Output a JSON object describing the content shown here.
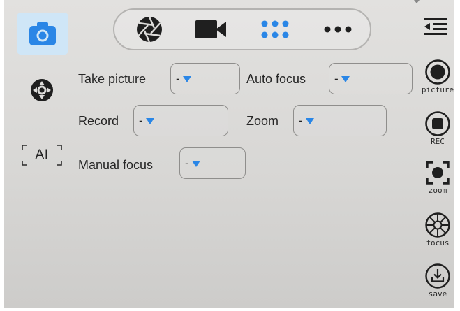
{
  "colors": {
    "accent": "#2a86e6",
    "icon": "#1f1f1f",
    "mode_tile_bg": "#cfe6f7"
  },
  "left_rail": {
    "camera_icon": "camera-icon",
    "settings_icon": "settings-wheel-icon",
    "ai_label": "AI"
  },
  "mode_bar": {
    "items": [
      {
        "icon": "aperture-icon"
      },
      {
        "icon": "video-camera-icon"
      },
      {
        "icon": "grid-dots-icon"
      },
      {
        "icon": "more-horizontal-icon"
      }
    ]
  },
  "form": {
    "take_picture": {
      "label": "Take picture",
      "value": "-"
    },
    "auto_focus": {
      "label": "Auto focus",
      "value": "-"
    },
    "record": {
      "label": "Record",
      "value": "-"
    },
    "zoom": {
      "label": "Zoom",
      "value": "-"
    },
    "manual_focus": {
      "label": "Manual focus",
      "value": "-"
    }
  },
  "right_rail": {
    "collapse_icon": "collapse-menu-icon",
    "picture_label": "picture",
    "rec_label": "REC",
    "zoom_label": "zoom",
    "focus_label": "focus",
    "save_label": "save"
  }
}
